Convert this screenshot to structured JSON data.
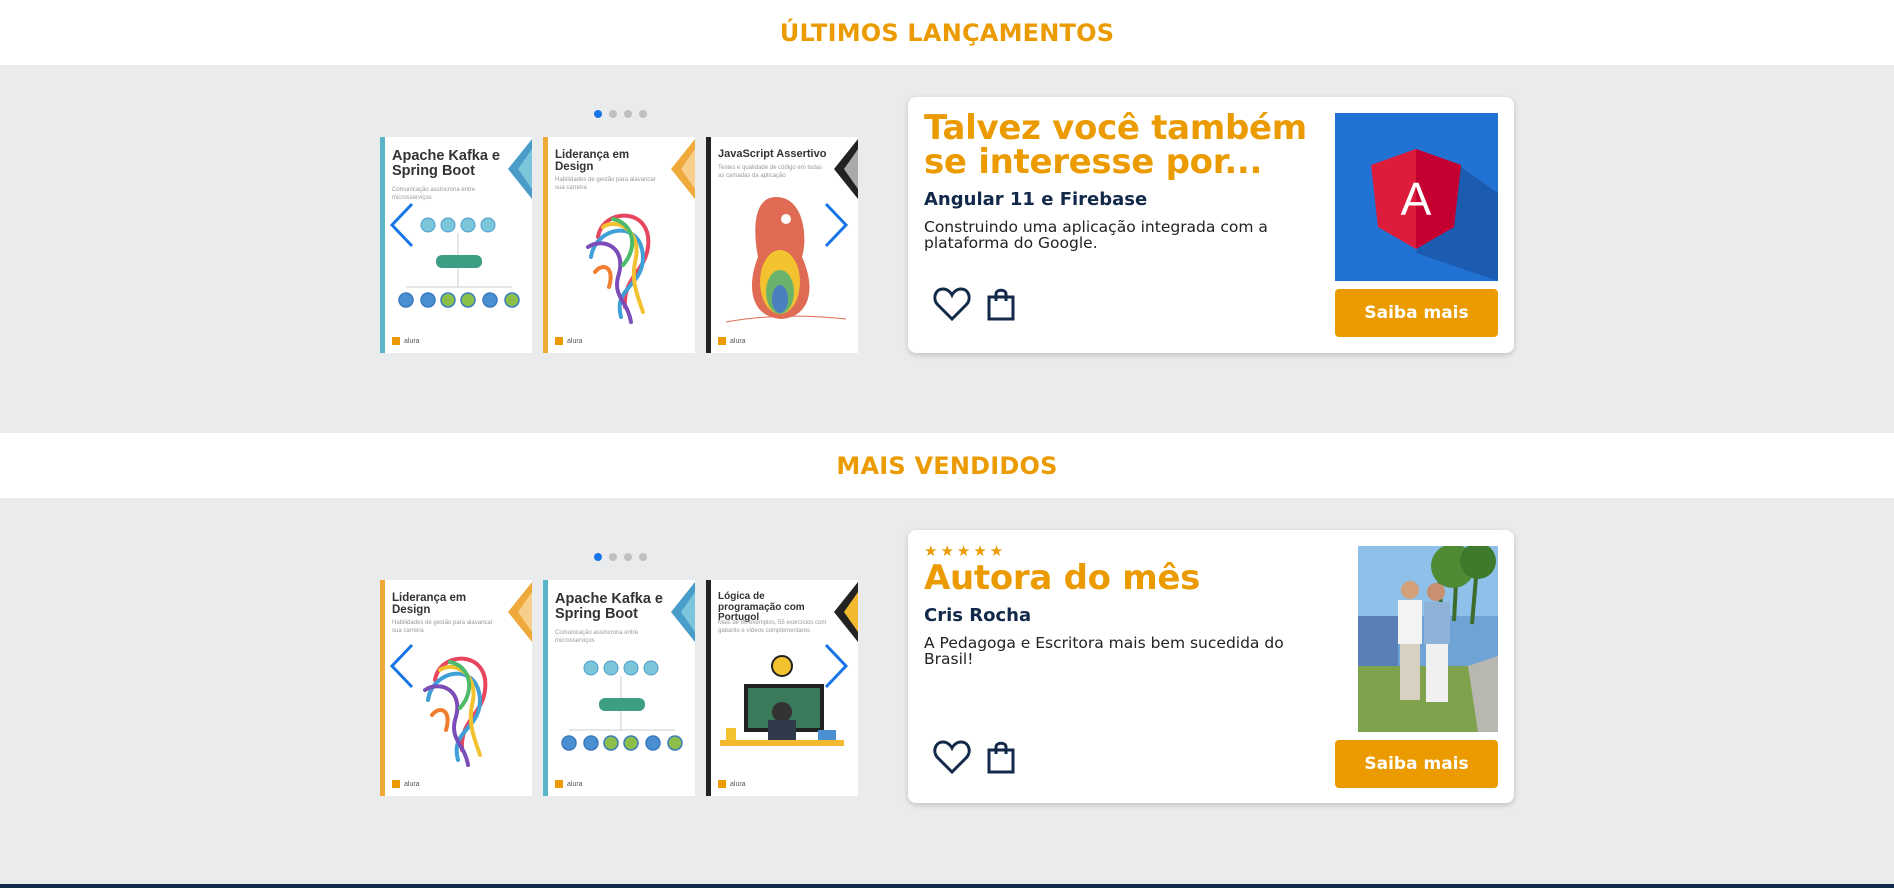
{
  "sections": [
    {
      "title": "ÚLTIMOS LANÇAMENTOS",
      "carousel": {
        "dots": 4,
        "active_dot": 1,
        "books": [
          {
            "title": "Apache Kafka e Spring Boot",
            "subtitle": "Comunicação assíncrona entre microsserviços",
            "publisher": "alura"
          },
          {
            "title": "Liderança em Design",
            "subtitle": "Habilidades de gestão para alavancar sua carreira",
            "publisher": "alura"
          },
          {
            "title": "JavaScript Assertivo",
            "subtitle": "Testes e qualidade de código em todas as camadas da aplicação",
            "publisher": "alura"
          }
        ],
        "prev_icon": "chevron-left-icon",
        "next_icon": "chevron-right-icon"
      },
      "card": {
        "heading": "Talvez você também se interesse por...",
        "subtitle": "Angular 11 e Firebase",
        "description": "Construindo uma aplicação integrada com a plataforma do Google.",
        "image_letter": "A",
        "button": "Saiba mais",
        "favorite_icon": "heart-icon",
        "bag_icon": "shopping-bag-icon"
      }
    },
    {
      "title": "MAIS VENDIDOS",
      "carousel": {
        "dots": 4,
        "active_dot": 1,
        "books": [
          {
            "title": "Liderança em Design",
            "subtitle": "Habilidades de gestão para alavancar sua carreira",
            "publisher": "alura"
          },
          {
            "title": "Apache Kafka e Spring Boot",
            "subtitle": "Comunicação assíncrona entre microsserviços",
            "publisher": "alura"
          },
          {
            "title": "Lógica de programação com Portugol",
            "subtitle": "Mais de 80 exemplos, 55 exercícios com gabarito e vídeos complementares",
            "publisher": "alura"
          }
        ],
        "prev_icon": "chevron-left-icon",
        "next_icon": "chevron-right-icon"
      },
      "card": {
        "stars": "★★★★★",
        "rating": 5,
        "heading": "Autora do mês",
        "subtitle": "Cris Rocha",
        "description": "A Pedagoga e Escritora mais bem sucedida do Brasil!",
        "button": "Saiba mais",
        "favorite_icon": "heart-icon",
        "bag_icon": "shopping-bag-icon"
      }
    }
  ],
  "colors": {
    "accent": "#EB9B00",
    "navy": "#12294A",
    "band": "#EAEBED",
    "active_dot": "#1875E8",
    "arrow": "#1875E8"
  }
}
